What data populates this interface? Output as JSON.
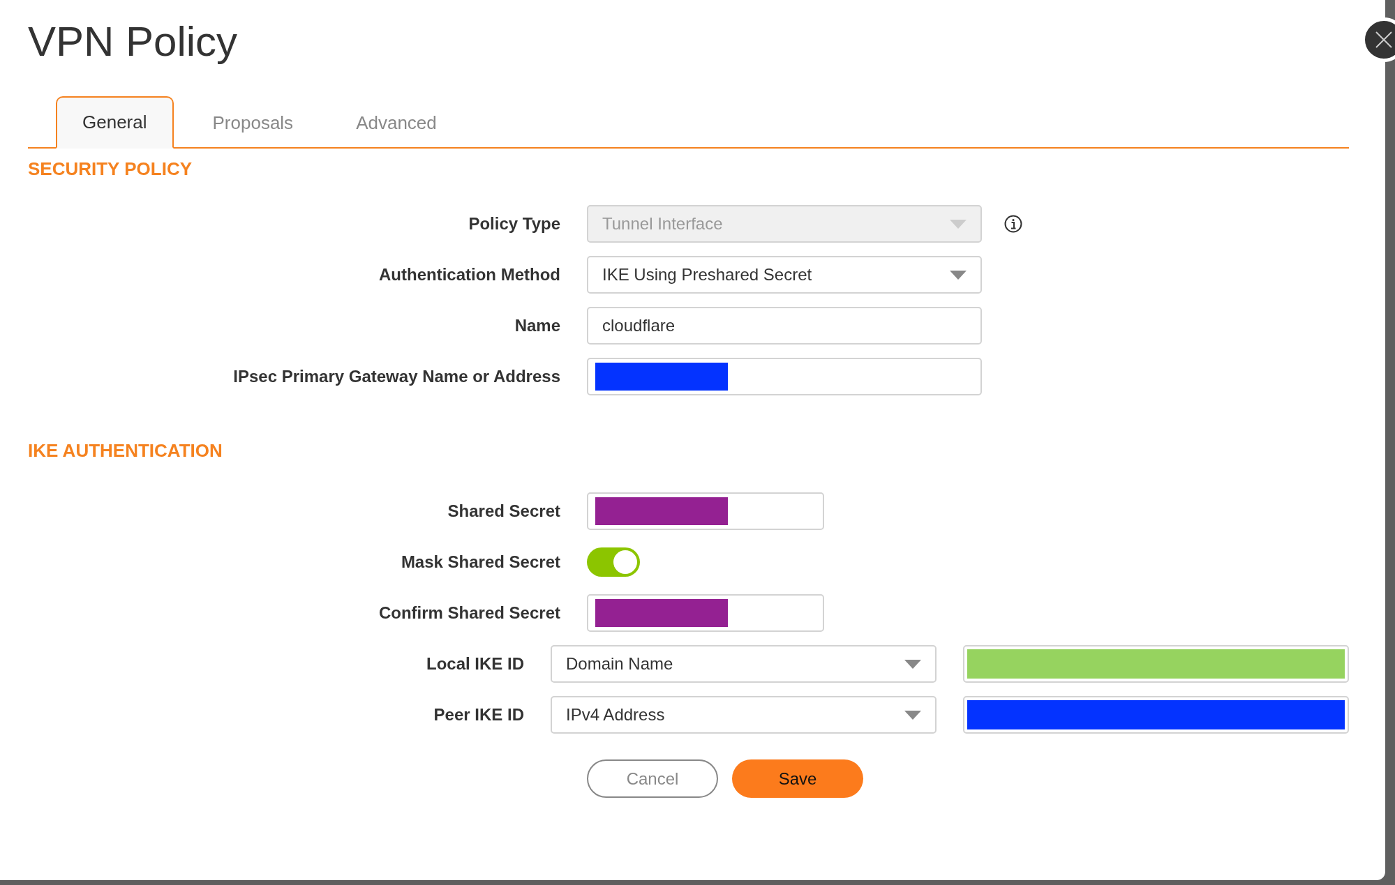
{
  "dialog": {
    "title": "VPN Policy"
  },
  "tabs": [
    {
      "label": "General",
      "selected": true
    },
    {
      "label": "Proposals",
      "selected": false
    },
    {
      "label": "Advanced",
      "selected": false
    }
  ],
  "sections": [
    {
      "heading": "SECURITY POLICY",
      "rows": [
        {
          "label": "Policy Type",
          "fields": [
            {
              "kind": "select",
              "value": "Tunnel Interface",
              "disabled": true
            }
          ],
          "info": true
        },
        {
          "label": "Authentication Method",
          "fields": [
            {
              "kind": "select",
              "value": "IKE Using Preshared Secret",
              "disabled": false
            }
          ]
        },
        {
          "label": "Name",
          "fields": [
            {
              "kind": "text",
              "value": "cloudflare"
            }
          ]
        },
        {
          "label": "IPsec Primary Gateway Name or Address",
          "fields": [
            {
              "kind": "redacted",
              "color": "#0433ff"
            }
          ]
        }
      ]
    },
    {
      "heading": "IKE AUTHENTICATION",
      "rows": [
        {
          "label": "Shared Secret",
          "fields": [
            {
              "kind": "redacted",
              "color": "#942192"
            }
          ]
        },
        {
          "label": "Mask Shared Secret",
          "fields": [
            {
              "kind": "toggle",
              "on": true
            }
          ]
        },
        {
          "label": "Confirm Shared Secret",
          "fields": [
            {
              "kind": "redacted",
              "color": "#942192"
            }
          ]
        },
        {
          "label": "Local IKE ID",
          "fields": [
            {
              "kind": "select",
              "value": "Domain Name",
              "disabled": false
            },
            {
              "kind": "redacted",
              "color": "#96d35f"
            }
          ]
        },
        {
          "label": "Peer IKE ID",
          "fields": [
            {
              "kind": "select",
              "value": "IPv4 Address",
              "disabled": false
            },
            {
              "kind": "redacted",
              "color": "#0433ff"
            }
          ]
        }
      ]
    }
  ],
  "buttons": [
    {
      "label": "Cancel",
      "kind": "secondary"
    },
    {
      "label": "Save",
      "kind": "primary"
    }
  ]
}
